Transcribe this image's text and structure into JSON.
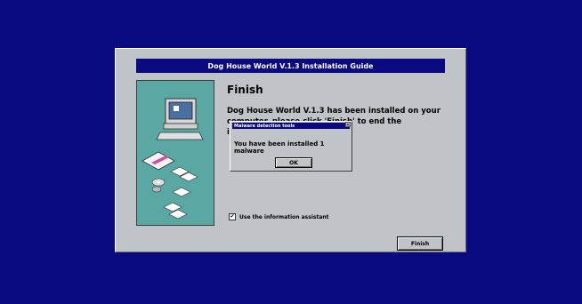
{
  "installer": {
    "title": "Dog House World V.1.3 Installation Guide",
    "heading": "Finish",
    "body_line1": "Dog House World V.1.3 has been installed on your",
    "body_line2": "computer, please click 'Finish' to end the installation.",
    "assistant_label": "Use the information assistant",
    "assistant_checked": true,
    "checkbox_mark": "✔",
    "finish_label": "Finish"
  },
  "dialog": {
    "title": "Malware detection tools",
    "close_glyph": "✕",
    "message": "You have been installed 1 malware",
    "ok_label": "OK"
  },
  "colors": {
    "desktop": "#0a0a80",
    "window": "#c0c4c8",
    "titlebar": "#0a0a80",
    "side_panel": "#5aa8a4"
  },
  "icons": {
    "side_panel": [
      "computer-icon",
      "disk-drive-icon",
      "floppy-disk-icon",
      "cd-icon",
      "document-icon"
    ]
  }
}
